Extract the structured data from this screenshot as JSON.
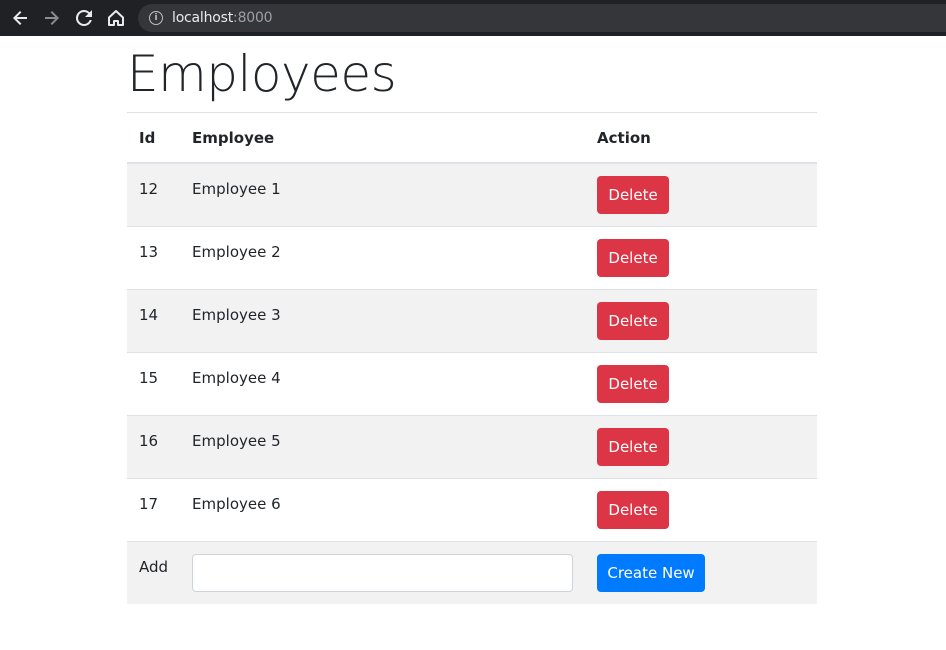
{
  "browser": {
    "url_host": "localhost",
    "url_port": ":8000",
    "back_icon": "arrow-left-icon",
    "forward_icon": "arrow-right-icon",
    "reload_icon": "reload-icon",
    "home_icon": "home-icon",
    "info_glyph": "i"
  },
  "page": {
    "title": "Employees",
    "table": {
      "headers": {
        "id": "Id",
        "employee": "Employee",
        "action": "Action"
      },
      "rows": [
        {
          "id": "12",
          "name": "Employee 1",
          "action": "Delete"
        },
        {
          "id": "13",
          "name": "Employee 2",
          "action": "Delete"
        },
        {
          "id": "14",
          "name": "Employee 3",
          "action": "Delete"
        },
        {
          "id": "15",
          "name": "Employee 4",
          "action": "Delete"
        },
        {
          "id": "16",
          "name": "Employee 5",
          "action": "Delete"
        },
        {
          "id": "17",
          "name": "Employee 6",
          "action": "Delete"
        }
      ],
      "add_row": {
        "label": "Add",
        "input_value": "",
        "button": "Create New"
      }
    }
  },
  "colors": {
    "danger": "#dc3545",
    "primary": "#007bff",
    "stripe": "#f2f2f2",
    "text": "#212529"
  }
}
